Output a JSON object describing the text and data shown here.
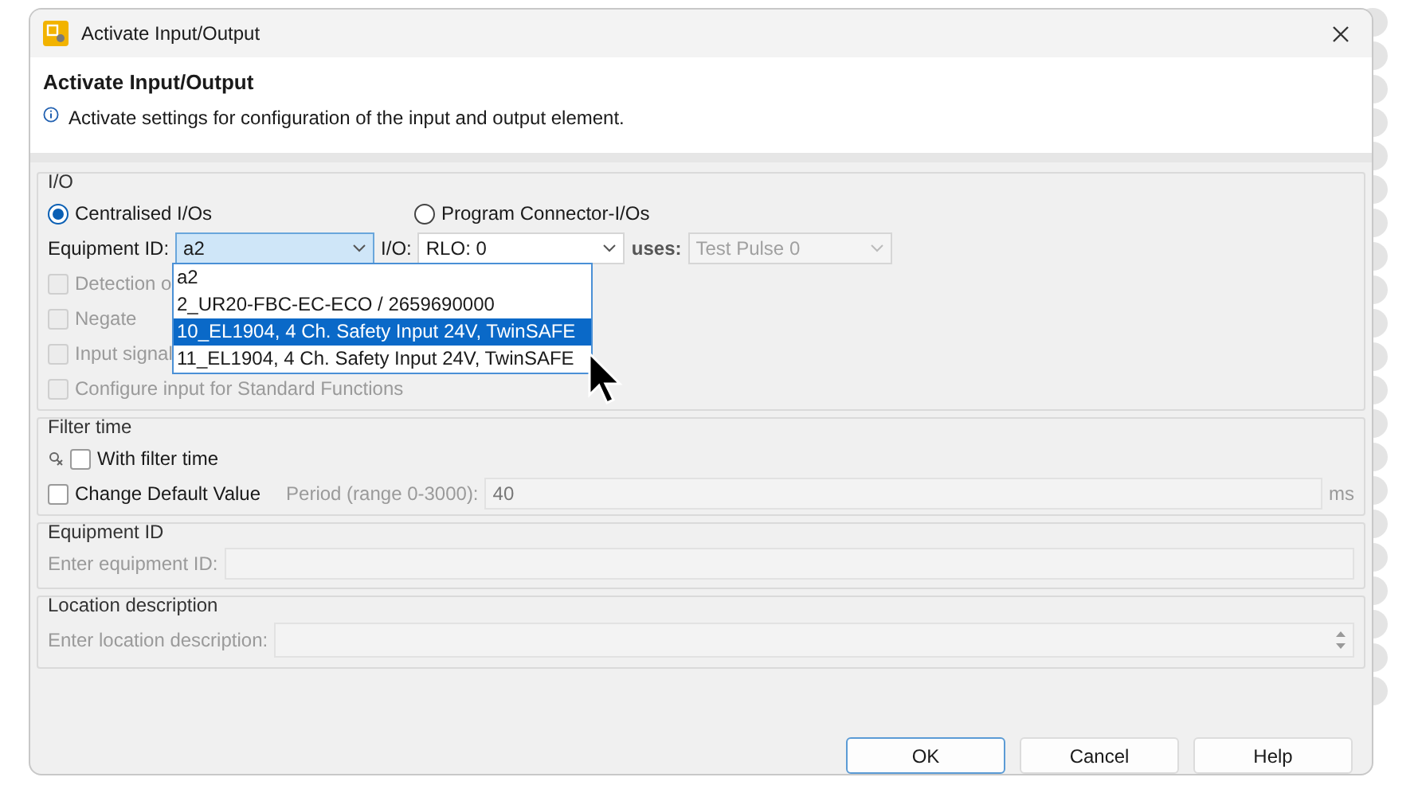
{
  "window": {
    "title": "Activate Input/Output"
  },
  "header": {
    "title": "Activate Input/Output",
    "description": "Activate settings for configuration of the input and output element."
  },
  "io_group": {
    "title": "I/O",
    "radios": [
      {
        "label": "Centralised I/Os",
        "selected": true
      },
      {
        "label": "Program Connector-I/Os",
        "selected": false
      }
    ],
    "equipment_id": {
      "label": "Equipment ID:",
      "value": "a2"
    },
    "io": {
      "label": "I/O:",
      "value": "RLO: 0"
    },
    "uses": {
      "label": "uses:",
      "value": "Test Pulse 0",
      "disabled": true
    },
    "dropdown": [
      {
        "label": "a2",
        "selected": false
      },
      {
        "label": "2_UR20-FBC-EC-ECO / 2659690000",
        "selected": false
      },
      {
        "label": "10_EL1904, 4 Ch. Safety Input 24V, TwinSAFE",
        "selected": true
      },
      {
        "label": "11_EL1904, 4 Ch. Safety Input 24V, TwinSAFE",
        "selected": false
      }
    ],
    "checkboxes": [
      {
        "label": "Detection o",
        "checked": false,
        "disabled": true
      },
      {
        "label": "Negate",
        "checked": false,
        "disabled": true
      },
      {
        "label": "Input signal",
        "checked": false,
        "disabled": true
      },
      {
        "label": "Configure input for Standard Functions",
        "checked": false,
        "disabled": true
      }
    ]
  },
  "filter_time": {
    "title": "Filter time",
    "with_filter": {
      "label": "With filter time",
      "checked": false,
      "disabled": false
    },
    "change_default": {
      "label": "Change Default Value",
      "checked": false,
      "disabled": false
    },
    "period_label": "Period (range 0-3000):",
    "period_value": "40",
    "unit": "ms"
  },
  "equipment_group": {
    "title": "Equipment ID",
    "label": "Enter equipment ID:"
  },
  "location_group": {
    "title": "Location description",
    "label": "Enter location description:"
  },
  "buttons": [
    {
      "label": "OK",
      "default": true
    },
    {
      "label": "Cancel",
      "default": false
    },
    {
      "label": "Help",
      "default": false
    }
  ]
}
